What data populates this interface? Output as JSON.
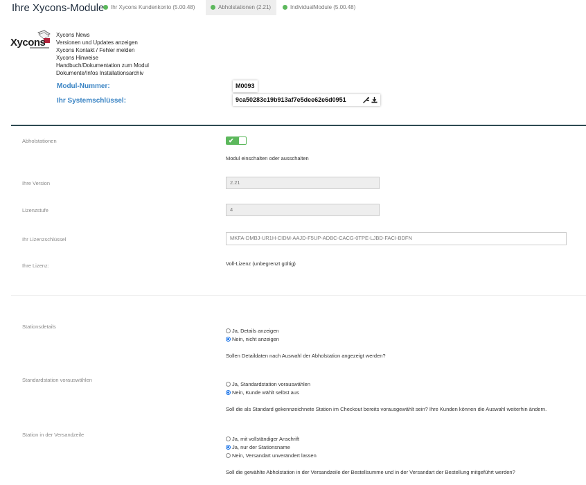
{
  "header": {
    "title": "Ihre Xycons-Module",
    "tabs": [
      {
        "label": "Ihr Xycons Kundenkonto (5.00.48)",
        "active": false
      },
      {
        "label": "Abholstationen (2.21)",
        "active": true
      },
      {
        "label": "IndividualModule (5.00.48)",
        "active": false
      }
    ]
  },
  "logo": {
    "text": "Xycons"
  },
  "links": [
    "Xycons News",
    "Versionen und Updates anzeigen",
    "Xycons Kontakt / Fehler melden",
    "Xycons Hinweise",
    "Handbuch/Dokumentation zum Modul",
    "Dokumente/Infos Installationsarchiv"
  ],
  "keys": {
    "modul_label": "Modul-Nummer:",
    "modul_value": "M0093",
    "system_label": "Ihr Systemschlüssel:",
    "system_value": "9ca50283c19b913af7e5dee62e6d0951"
  },
  "settings": {
    "module": {
      "label": "Abholstationen",
      "enabled": true,
      "help": "Modul einschalten oder ausschalten"
    },
    "version": {
      "label": "Ihre Version",
      "value": "2.21"
    },
    "level": {
      "label": "Lizenzstufe",
      "value": "4"
    },
    "license_key": {
      "label": "Ihr Lizenzschlüssel",
      "value": "MKFA-DMBJ-UR1H-CIDM-AAJD-F5UP-ADBC-CACG-0TPE-LJBD-FACI-BDFN"
    },
    "license": {
      "label": "Ihre Lizenz:",
      "value": "Voll-Lizenz (unbegrenzt gültig)"
    },
    "station_details": {
      "label": "Stationsdetails",
      "options": [
        "Ja, Details anzeigen",
        "Nein, nicht anzeigen"
      ],
      "selected": 1,
      "help": "Sollen Detaildaten nach Auswahl der Abholstation angezeigt werden?"
    },
    "default_station": {
      "label": "Standardstation vorauswählen",
      "options": [
        "Ja, Standardstation vorauswählen",
        "Nein, Kunde wählt selbst aus"
      ],
      "selected": 1,
      "help": "Soll die als Standard gekennzeichnete Station im Checkout bereits vorausgewählt sein? Ihre Kunden können die Auswahl weiterhin ändern."
    },
    "shipping_line": {
      "label": "Station in der Versandzeile",
      "options": [
        "Ja, mit vollständiger Anschrift",
        "Ja, nur der Stationsname",
        "Nein, Versandart unverändert lassen"
      ],
      "selected": 1,
      "help": "Soll die gewählte Abholstation in der Versandzeile der Bestellsumme und in der Versandart der Bestellung mitgeführt werden?"
    }
  }
}
